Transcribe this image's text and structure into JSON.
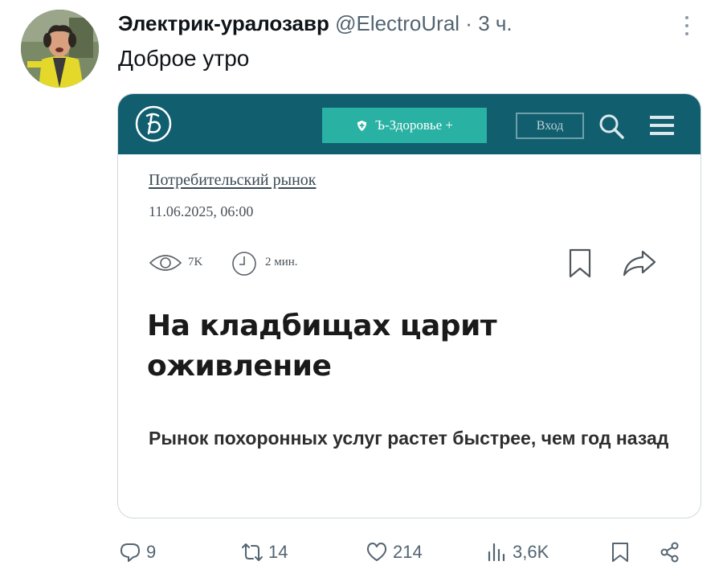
{
  "tweet": {
    "author": "Электрик-уралозавр",
    "handle": "@ElectroUral",
    "separator": "·",
    "time": "3 ч.",
    "text": "Доброе утро"
  },
  "card": {
    "health_button": "Ъ-Здоровье +",
    "login_button": "Вход",
    "rubric": "Потребительский рынок",
    "date": "11.06.2025, 06:00",
    "views": "7K",
    "read_time": "2 мин.",
    "headline": "На кладбищах царит оживление",
    "lead": "Рынок похоронных услуг растет быстрее, чем год назад"
  },
  "actions": {
    "replies": "9",
    "reposts": "14",
    "likes": "214",
    "views": "3,6K"
  },
  "colors": {
    "site_bar": "#115e6f",
    "health_button": "#29b1a3",
    "muted_text": "#536471"
  },
  "icons": [
    "logo-icon",
    "shield-icon",
    "search-icon",
    "menu-icon",
    "eye-icon",
    "clock-icon",
    "bookmark-icon",
    "share-icon",
    "reply-icon",
    "repost-icon",
    "like-icon",
    "views-icon",
    "more-icon"
  ]
}
